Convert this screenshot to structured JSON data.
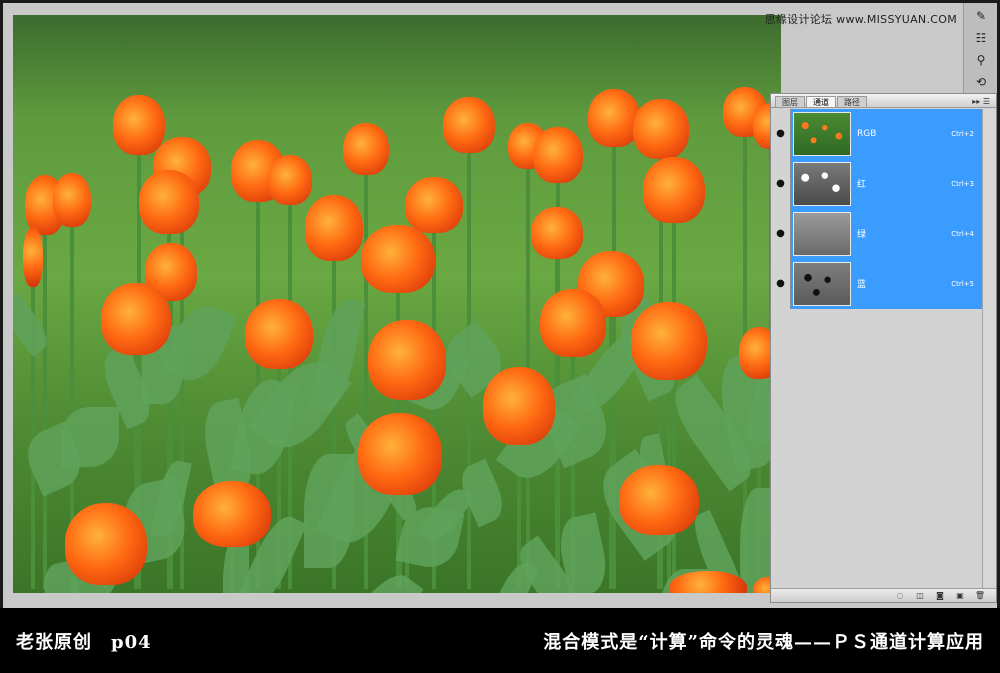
{
  "watermark": {
    "text": "思缘设计论坛 www.MISSYUAN.COM"
  },
  "toolstrip": {
    "icons": [
      "brush-icon",
      "mixer-icon",
      "stamp-icon",
      "history-icon"
    ]
  },
  "panel": {
    "tabs": [
      {
        "label": "图层",
        "active": false
      },
      {
        "label": "通道",
        "active": true
      },
      {
        "label": "路径",
        "active": false
      }
    ],
    "menu_label": "▸▸ ☰",
    "channels": [
      {
        "name": "RGB",
        "shortcut": "Ctrl+2",
        "thumb": "rgb"
      },
      {
        "name": "红",
        "shortcut": "Ctrl+3",
        "thumb": "red"
      },
      {
        "name": "绿",
        "shortcut": "Ctrl+4",
        "thumb": "green"
      },
      {
        "name": "蓝",
        "shortcut": "Ctrl+5",
        "thumb": "blue"
      }
    ],
    "bottom_buttons": [
      "◌",
      "◫",
      "◙",
      "▣",
      "🗑"
    ]
  },
  "caption": {
    "left": "老张原创　p04",
    "right": "混合模式是“计算”命令的灵魂——ＰＳ通道计算应用"
  }
}
